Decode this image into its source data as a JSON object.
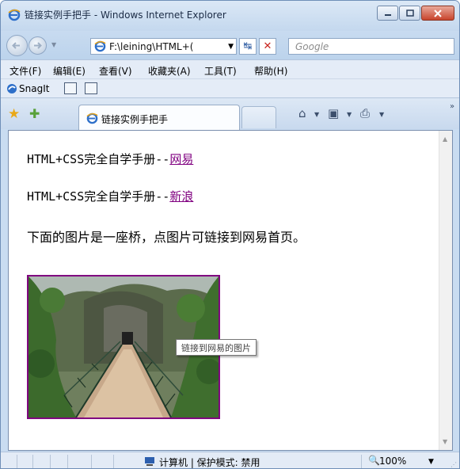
{
  "window": {
    "title": "链接实例手把手 - Windows Internet Explorer"
  },
  "toolbar": {
    "address_value": "F:\\leining\\HTML+(",
    "search_placeholder": "Google"
  },
  "menubar": {
    "items": [
      "文件(F)",
      "编辑(E)",
      "查看(V)",
      "收藏夹(A)",
      "工具(T)",
      "帮助(H)"
    ]
  },
  "snagit": {
    "label": "SnagIt"
  },
  "tabs": {
    "active_label": "链接实例手把手"
  },
  "content": {
    "line1_prefix": "HTML+CSS完全自学手册--",
    "line1_link": "网易",
    "line2_prefix": "HTML+CSS完全自学手册--",
    "line2_link": "新浪",
    "line3": "下面的图片是一座桥，点图片可链接到网易首页。",
    "image_tooltip": "链接到网易的图片"
  },
  "statusbar": {
    "zone": "计算机 | 保护模式: 禁用",
    "zoom": "100%"
  },
  "colors": {
    "visited_link": "#800080",
    "window_frame": "#c9dcf1"
  }
}
